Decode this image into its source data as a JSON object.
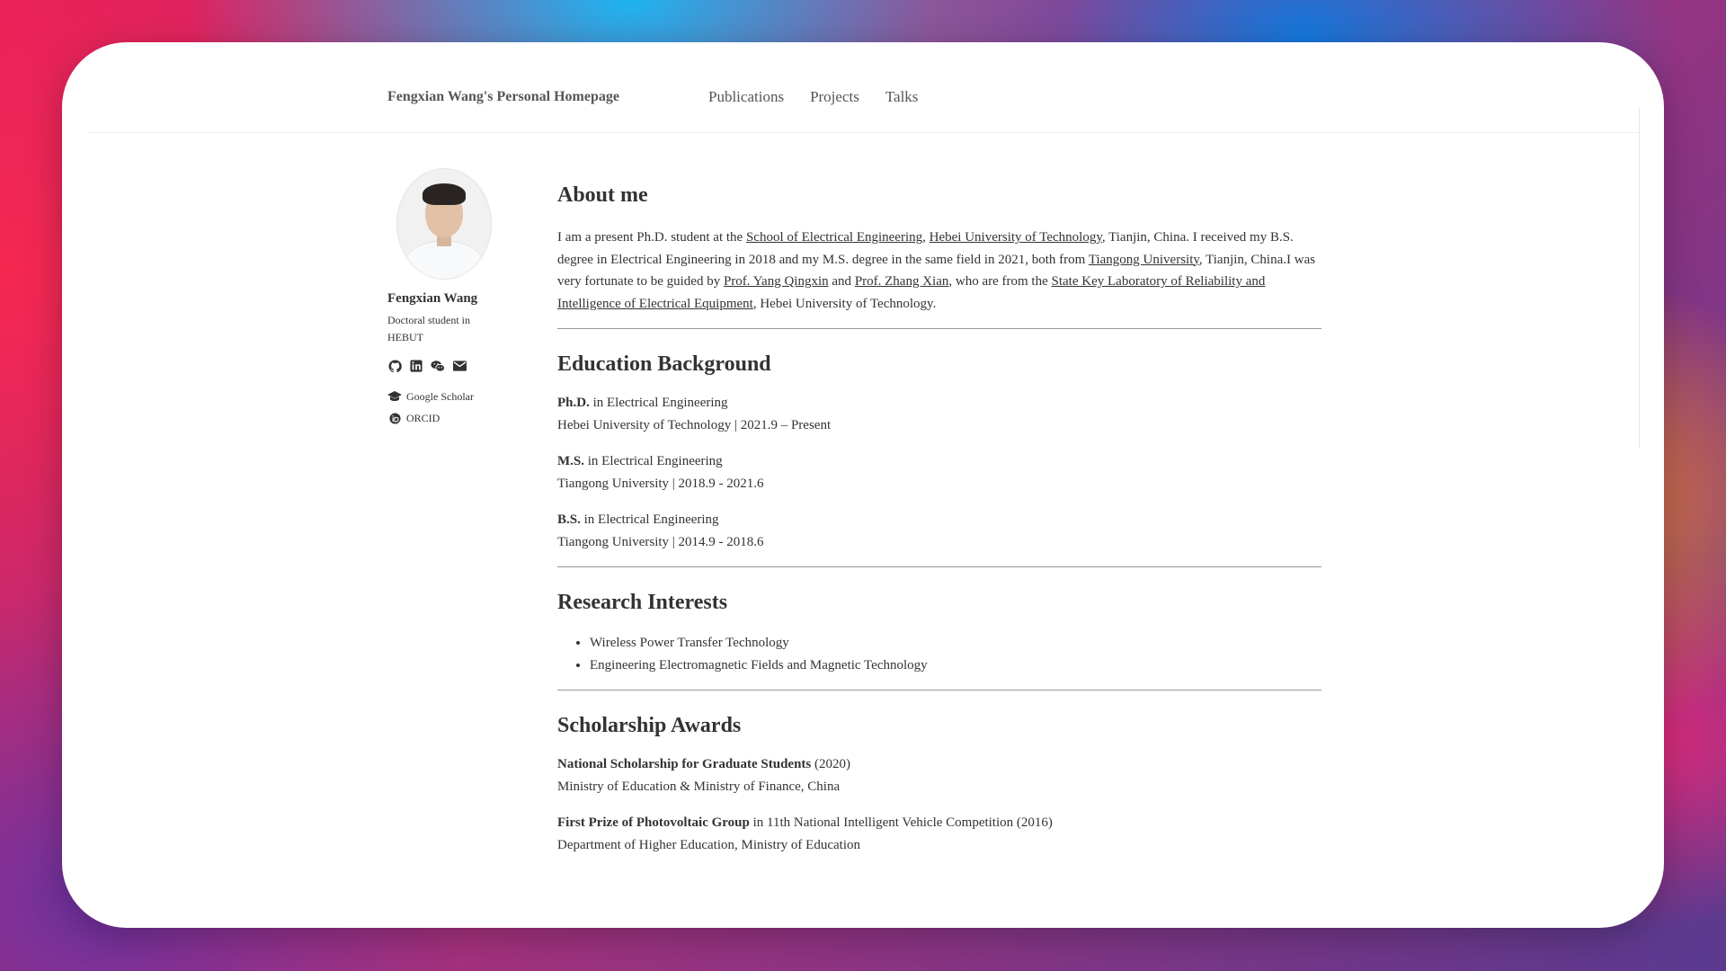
{
  "header": {
    "site_title": "Fengxian Wang's Personal Homepage",
    "nav": [
      "Publications",
      "Projects",
      "Talks"
    ]
  },
  "sidebar": {
    "name": "Fengxian Wang",
    "bio": "Doctoral student in HEBUT",
    "social_icons": [
      "github-icon",
      "linkedin-icon",
      "wechat-icon",
      "email-icon"
    ],
    "links": [
      {
        "icon": "graduation-cap-icon",
        "label": "Google Scholar"
      },
      {
        "icon": "orcid-icon",
        "label": "ORCID"
      }
    ]
  },
  "about": {
    "heading": "About me",
    "t1": "I am a present Ph.D. student at the ",
    "l1": "School of Electrical Engineering",
    "t2": ", ",
    "l2": "Hebei University of Technology",
    "t3": ", Tianjin, China. I received my B.S. degree in Electrical Engineering in 2018 and my M.S. degree in the same field in 2021, both from ",
    "l3": "Tiangong University",
    "t4": ", Tianjin, China.I was very fortunate to be guided by ",
    "l4": "Prof. Yang Qingxin",
    "t5": " and ",
    "l5": "Prof. Zhang Xian",
    "t6": ", who are from the ",
    "l6": "State Key Laboratory of Reliability and Intelligence of Electrical Equipment",
    "t7": ", Hebei University of Technology."
  },
  "education": {
    "heading": "Education Background",
    "items": [
      {
        "degree": "Ph.D.",
        "field": " in Electrical Engineering",
        "detail": "Hebei University of Technology | 2021.9 – Present"
      },
      {
        "degree": "M.S.",
        "field": " in Electrical Engineering",
        "detail": "Tiangong University | 2018.9 - 2021.6"
      },
      {
        "degree": "B.S.",
        "field": " in Electrical Engineering",
        "detail": "Tiangong University | 2014.9 - 2018.6"
      }
    ]
  },
  "research": {
    "heading": "Research Interests",
    "items": [
      "Wireless Power Transfer Technology",
      "Engineering Electromagnetic Fields and Magnetic Technology"
    ]
  },
  "awards": {
    "heading": "Scholarship Awards",
    "items": [
      {
        "title": "National Scholarship for Graduate Students",
        "suffix": " (2020)",
        "issuer": "Ministry of Education & Ministry of Finance, China"
      },
      {
        "title": "First Prize of Photovoltaic Group",
        "suffix": " in 11th National Intelligent Vehicle Competition (2016)",
        "issuer": "Department of Higher Education, Ministry of Education"
      }
    ]
  }
}
